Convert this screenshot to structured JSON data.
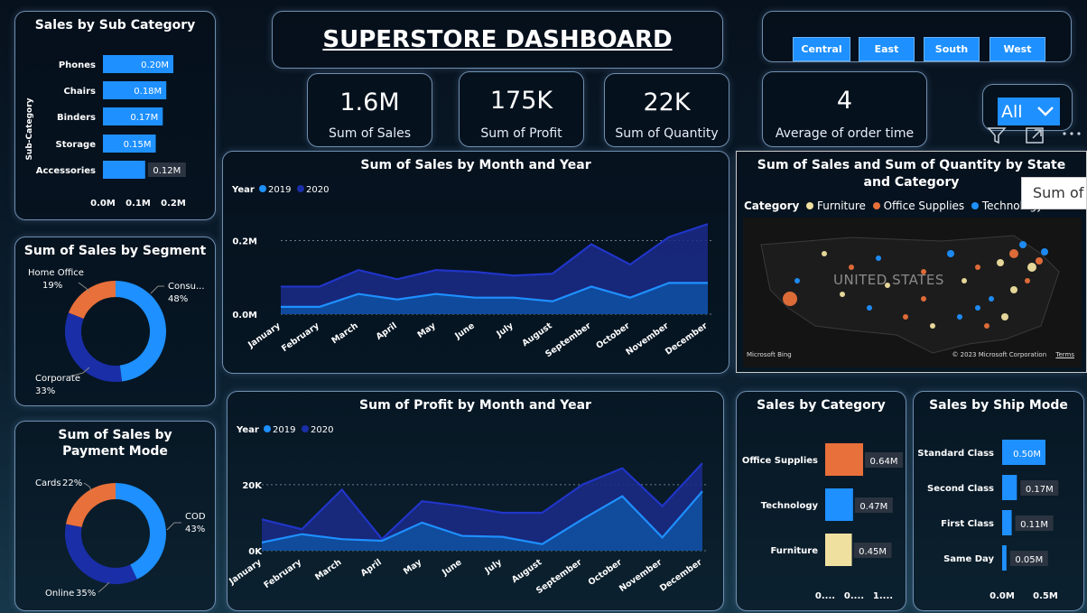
{
  "dashboard_title": "SUPERSTORE DASHBOARD",
  "regions": [
    "Central",
    "East",
    "South",
    "West"
  ],
  "kpis": [
    {
      "value": "1.6M",
      "label": "Sum of Sales"
    },
    {
      "value": "175K",
      "label": "Sum of Profit"
    },
    {
      "value": "22K",
      "label": "Sum of Quantity"
    },
    {
      "value": "4",
      "label": "Average of order time"
    }
  ],
  "slicer": {
    "selected": "All"
  },
  "tooltip_text": "Sum of",
  "map": {
    "title": "Sum of Sales and Sum of Quantity by State and Category",
    "legend_title": "Category",
    "legend": [
      "Furniture",
      "Office Supplies",
      "Technology"
    ],
    "country_label": "UNITED STATES",
    "attribution": "© 2023 Microsoft Corporation",
    "terms": "Terms",
    "bing": "Microsoft Bing"
  },
  "colors": {
    "accent_blue": "#1e90ff",
    "dark_blue": "#1a2ea8",
    "orange": "#e8703a",
    "beige": "#f0e0a0"
  },
  "chart_data": [
    {
      "id": "sub_category",
      "type": "bar",
      "title": "Sales by Sub Category",
      "ylabel": "Sub-Category",
      "categories": [
        "Phones",
        "Chairs",
        "Binders",
        "Storage",
        "Accessories"
      ],
      "values": [
        0.2,
        0.18,
        0.17,
        0.15,
        0.12
      ],
      "labels": [
        "0.20M",
        "0.18M",
        "0.17M",
        "0.15M",
        "0.12M"
      ],
      "ticks": [
        "0.0M",
        "0.1M",
        "0.2M"
      ],
      "xlim": [
        0,
        0.2
      ]
    },
    {
      "id": "segment",
      "type": "pie",
      "title": "Sum of Sales by Segment",
      "categories": [
        "Consu...",
        "Corporate",
        "Home Office"
      ],
      "values": [
        48,
        33,
        19
      ],
      "labels": [
        "48%",
        "33%",
        "19%"
      ]
    },
    {
      "id": "payment",
      "type": "pie",
      "title": "Sum of Sales by Payment Mode",
      "categories": [
        "COD",
        "Online",
        "Cards"
      ],
      "values": [
        43,
        35,
        22
      ],
      "labels": [
        "43%",
        "35%",
        "22%"
      ]
    },
    {
      "id": "sales_month",
      "type": "area",
      "title": "Sum of Sales by Month and Year",
      "legend_title": "Year",
      "categories": [
        "January",
        "February",
        "March",
        "April",
        "May",
        "June",
        "July",
        "August",
        "September",
        "October",
        "November",
        "December"
      ],
      "series": [
        {
          "name": "2019",
          "values": [
            0.02,
            0.02,
            0.055,
            0.04,
            0.055,
            0.045,
            0.045,
            0.035,
            0.075,
            0.045,
            0.085,
            0.085
          ]
        },
        {
          "name": "2020",
          "values": [
            0.075,
            0.075,
            0.12,
            0.095,
            0.12,
            0.115,
            0.105,
            0.11,
            0.19,
            0.135,
            0.21,
            0.245
          ]
        }
      ],
      "ticks": [
        "0.0M",
        "0.2M"
      ],
      "ylim": [
        0,
        0.27
      ]
    },
    {
      "id": "profit_month",
      "type": "area",
      "title": "Sum of Profit by Month and Year",
      "legend_title": "Year",
      "categories": [
        "January",
        "February",
        "March",
        "April",
        "May",
        "June",
        "July",
        "August",
        "September",
        "October",
        "November",
        "December"
      ],
      "series": [
        {
          "name": "2019",
          "values": [
            2500,
            5000,
            3500,
            3000,
            8500,
            4500,
            4200,
            2000,
            9500,
            16500,
            4000,
            18000
          ]
        },
        {
          "name": "2020",
          "values": [
            9500,
            6500,
            18500,
            3500,
            15000,
            13500,
            11500,
            11500,
            20000,
            25000,
            13500,
            26500
          ]
        }
      ],
      "ticks": [
        "0K",
        "20K"
      ],
      "ylim": [
        0,
        29000
      ]
    },
    {
      "id": "category",
      "type": "bar",
      "title": "Sales by Category",
      "categories": [
        "Office Supplies",
        "Technology",
        "Furniture"
      ],
      "values": [
        0.64,
        0.47,
        0.45
      ],
      "labels": [
        "0.64M",
        "0.47M",
        "0.45M"
      ],
      "ticks": [
        "0....",
        "0....",
        "1...."
      ]
    },
    {
      "id": "ship_mode",
      "type": "bar",
      "title": "Sales by Ship Mode",
      "categories": [
        "Standard Class",
        "Second Class",
        "First Class",
        "Same Day"
      ],
      "values": [
        0.5,
        0.17,
        0.11,
        0.05
      ],
      "labels": [
        "0.50M",
        "0.17M",
        "0.11M",
        "0.05M"
      ],
      "ticks": [
        "0.0M",
        "0.5M"
      ],
      "xlim": [
        0,
        0.5
      ]
    }
  ]
}
